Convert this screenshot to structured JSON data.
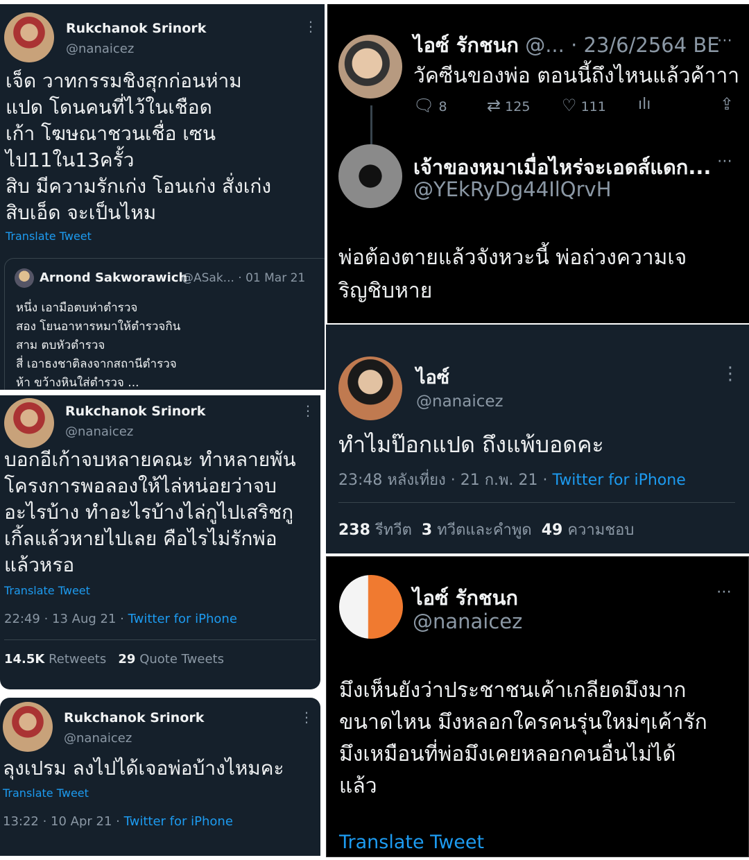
{
  "left": {
    "tweet1": {
      "name": "Rukchanok Srinork",
      "handle": "@nanaicez",
      "lines": [
        "เจ็ด วาทกรรมชิงสุกก่อนห่าม",
        "แปด โดนคนที่ไว้ในเชือด",
        "เก้า โฆษณาชวนเชื่อ เซน",
        "ไป11ใน13ครั้ว",
        "สิบ มีความรักเก่ง โอนเก่ง สั่งเก่ง",
        "สิบเอ็ด จะเป็นไหม"
      ],
      "translate": "Translate Tweet",
      "quote": {
        "name": "Arnond Sakworawich",
        "handle_date": "@ASak... · 01 Mar 21",
        "lines": [
          "หนึ่ง เอามือตบห่าตำรวจ",
          "สอง โยนอาหารหมาให้ตำรวจกิน",
          "สาม ตบหัวตำรวจ",
          "สี่ เอาธงชาติลงจากสถานีตำรวจ",
          "ห้า ขว้างหินใส่ตำรวจ ..."
        ]
      }
    },
    "tweet2": {
      "name": "Rukchanok Srinork",
      "handle": "@nanaicez",
      "lines": [
        "บอกอีเก้าจบหลายคณะ ทำหลายพัน",
        "โครงการพอลองให้ไล่หน่อยว่าจบ",
        "อะไรบ้าง ทำอะไรบ้างไล่กูไปเสริชกู",
        "เกิ้ลแล้วหายไปเลย คือไรไม่รักพ่อ",
        "แล้วหรอ"
      ],
      "translate": "Translate Tweet",
      "time": "22:49 · 13 Aug 21 · ",
      "source": "Twitter for iPhone",
      "retweets_num": "14.5K",
      "retweets_label": "Retweets",
      "quotes_num": "29",
      "quotes_label": "Quote Tweets"
    },
    "tweet3": {
      "name": "Rukchanok Srinork",
      "handle": "@nanaicez",
      "text": "ลุงเปรม ลงไปได้เจอพ่อบ้างไหมคะ",
      "translate": "Translate Tweet",
      "time": "13:22 · 10 Apr 21 · ",
      "source": "Twitter for iPhone"
    }
  },
  "right": {
    "tweet1": {
      "name": "ไอซ์ รักชนก",
      "handle_date": "@... · 23/6/2564 BE",
      "text": "วัคซีนของพ่อ ตอนนี้ถึงไหนแล้วค้าาา",
      "replies": "8",
      "retweets": "125",
      "likes": "111"
    },
    "tweet2": {
      "name": "เจ้าของหมาเมื่อไหร่จะเอดส์แดก...",
      "handle": "@YEkRyDg44IlQrvH",
      "lines": [
        "พ่อต้องตายแล้วจังหวะนี้ พ่อถ่วงความเจ",
        "ริญชิบหาย"
      ]
    },
    "tweet3": {
      "name": "ไอซ์",
      "handle": "@nanaicez",
      "text": "ทำไมป๊อกแปด ถึงแพ้บอดคะ",
      "time": "23:48 หลังเที่ยง · 21 ก.พ. 21 · ",
      "source": "Twitter for iPhone",
      "retweets_num": "238",
      "retweets_label": "รีทวีต",
      "quotes_num": "3",
      "quotes_label": "ทวีตและคำพูด",
      "likes_num": "49",
      "likes_label": "ความชอบ"
    },
    "tweet4": {
      "name": "ไอซ์ รักชนก",
      "handle": "@nanaicez",
      "lines": [
        "มึงเห็นยังว่าประชาชนเค้าเกลียดมึงมาก",
        "ขนาดไหน มึงหลอกใครคนรุ่นใหม่ๆเค้ารัก",
        "มึงเหมือนที่พ่อมึงเคยหลอกคนอื่นไม่ได้",
        "แล้ว"
      ],
      "translate": "Translate Tweet"
    }
  },
  "colors": {
    "dim_bg": "#15202b",
    "black_bg": "#000000",
    "link": "#1d9bf0",
    "muted": "#8b98a5",
    "text": "#e7e9ea"
  }
}
